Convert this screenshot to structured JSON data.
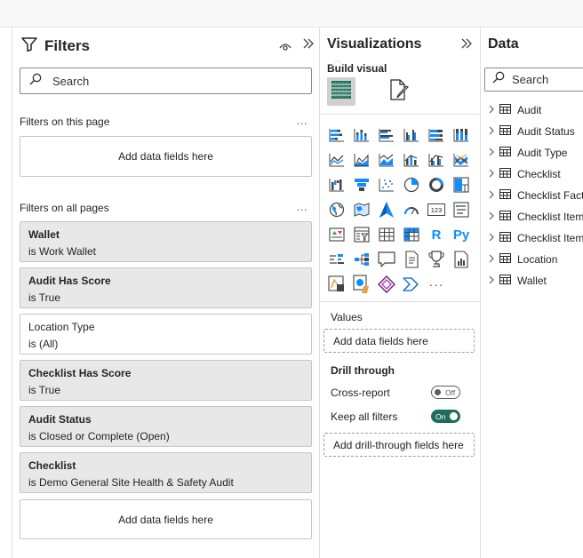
{
  "filters": {
    "title": "Filters",
    "search_placeholder": "Search",
    "on_this_page": {
      "label": "Filters on this page",
      "add_text": "Add data fields here"
    },
    "on_all_pages": {
      "label": "Filters on all pages",
      "cards": [
        {
          "title": "Wallet",
          "value": "is Work Wallet",
          "selected": true
        },
        {
          "title": "Audit Has Score",
          "value": "is True",
          "selected": true
        },
        {
          "title": "Location Type",
          "value": "is (All)",
          "selected": false
        },
        {
          "title": "Checklist Has Score",
          "value": "is True",
          "selected": true
        },
        {
          "title": "Audit Status",
          "value": "is Closed or Complete (Open)",
          "selected": true
        },
        {
          "title": "Checklist",
          "value": "is Demo General Site Health & Safety Audit",
          "selected": true
        }
      ],
      "add_text": "Add data fields here"
    },
    "more": "…"
  },
  "visualizations": {
    "title": "Visualizations",
    "build_visual": "Build visual",
    "icons": [
      "stacked-bar-chart-icon",
      "stacked-column-chart-icon",
      "clustered-bar-chart-icon",
      "clustered-column-chart-icon",
      "100-stacked-bar-chart-icon",
      "100-stacked-column-chart-icon",
      "line-chart-icon",
      "area-chart-icon",
      "stacked-area-chart-icon",
      "line-and-stacked-column-icon",
      "line-and-clustered-column-icon",
      "ribbon-chart-icon",
      "waterfall-chart-icon",
      "funnel-chart-icon",
      "scatter-chart-icon",
      "pie-chart-icon",
      "donut-chart-icon",
      "treemap-icon",
      "map-icon",
      "filled-map-icon",
      "azure-map-icon",
      "gauge-icon",
      "card-icon",
      "multi-row-card-icon",
      "kpi-icon",
      "slicer-icon",
      "table-icon",
      "matrix-icon",
      "r-visual-icon",
      "python-visual-icon",
      "key-influencers-icon",
      "decomposition-tree-icon",
      "qa-icon",
      "smart-narrative-icon",
      "metrics-icon",
      "paginated-report-icon",
      "power-apps-icon",
      "power-automate-icon",
      "power-apps-diamond-icon",
      "power-automate-arrows-icon",
      "more-visuals-icon"
    ],
    "r_label": "R",
    "py_label": "Py",
    "card_label": "123",
    "more_label": "···",
    "values_label": "Values",
    "values_add": "Add data fields here",
    "drill_through": "Drill through",
    "cross_report": "Cross-report",
    "cross_report_state": "Off",
    "keep_all_filters": "Keep all filters",
    "keep_all_filters_state": "On",
    "drill_add": "Add drill-through fields here"
  },
  "data": {
    "title": "Data",
    "search_placeholder": "Search",
    "tables": [
      "Audit",
      "Audit Status",
      "Audit Type",
      "Checklist",
      "Checklist Fact",
      "Checklist Item",
      "Checklist Item",
      "Location",
      "Wallet"
    ]
  },
  "colors": {
    "accent_green": "#1e6e5b",
    "selected_card": "#e8e8e8",
    "viz_blue": "#118dff"
  }
}
